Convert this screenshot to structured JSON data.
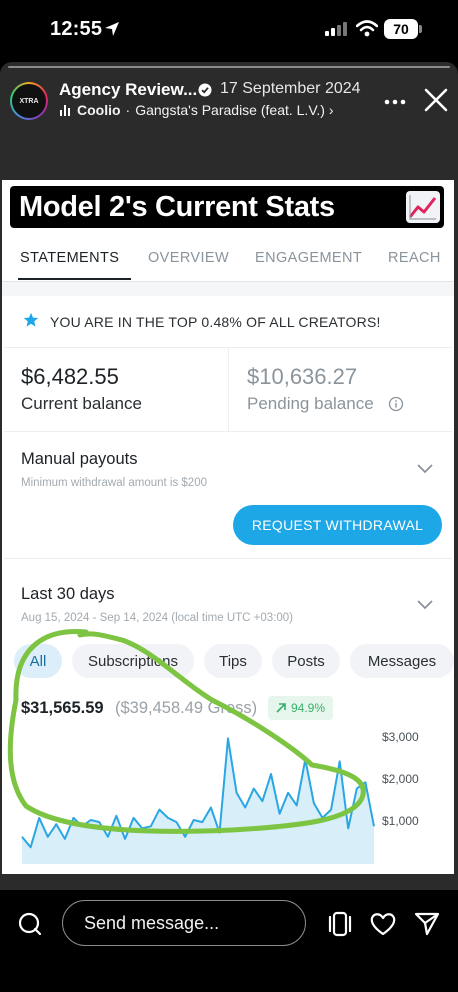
{
  "status_bar": {
    "time": "12:55",
    "battery": "70",
    "icons": [
      "location-arrow-icon",
      "cellular-signal-icon",
      "wifi-icon",
      "battery-icon"
    ]
  },
  "story_header": {
    "account_name": "Agency Review...",
    "date": "17 September 2024",
    "music_artist": "Coolio",
    "music_separator": " · ",
    "music_track": "Gangsta's Paradise (feat. L.V.) ›",
    "icons": [
      "verified-badge-icon",
      "music-bars-icon",
      "more-options-icon",
      "close-icon"
    ]
  },
  "card": {
    "title": "Model 2's Current Stats",
    "title_icon": "chart-increasing-icon",
    "tabs": [
      {
        "label": "STATEMENTS",
        "active": true
      },
      {
        "label": "OVERVIEW",
        "active": false
      },
      {
        "label": "ENGAGEMENT",
        "active": false
      },
      {
        "label": "REACH",
        "active": false
      }
    ],
    "top_notice": "YOU ARE IN THE TOP 0.48% OF ALL CREATORS!",
    "current_balance": {
      "amount": "$6,482.55",
      "label": "Current balance"
    },
    "pending_balance": {
      "amount": "$10,636.27",
      "label": "Pending balance"
    },
    "payouts": {
      "title": "Manual payouts",
      "subtitle": "Minimum withdrawal amount is $200",
      "button": "REQUEST WITHDRAWAL"
    },
    "period": {
      "title": "Last 30 days",
      "subtitle": "Aug 15, 2024 - Sep 14, 2024 (local time UTC +03:00)"
    },
    "filters": [
      {
        "label": "All",
        "active": true
      },
      {
        "label": "Subscriptions",
        "active": false
      },
      {
        "label": "Tips",
        "active": false
      },
      {
        "label": "Posts",
        "active": false
      },
      {
        "label": "Messages",
        "active": false
      }
    ],
    "earnings": {
      "net": "$31,565.59",
      "gross": "($39,458.49 Gross)",
      "change": "94.9%"
    },
    "colors": {
      "accent": "#1ea7e7",
      "chart_line": "#2aa6e3",
      "chart_fill": "#d8eef9",
      "annotation": "#7cc442",
      "positive": "#38b06a"
    }
  },
  "chart_data": {
    "type": "area",
    "y_ticks": [
      "$3,000",
      "$2,000",
      "$1,000"
    ],
    "ylim": [
      0,
      3200
    ],
    "grid": false,
    "values": [
      650,
      400,
      1100,
      650,
      950,
      600,
      1100,
      900,
      1050,
      1000,
      650,
      1150,
      600,
      1100,
      850,
      900,
      1300,
      1100,
      1000,
      650,
      1050,
      1000,
      1350,
      750,
      3000,
      1700,
      1350,
      1800,
      1500,
      2150,
      1200,
      1700,
      1400,
      2500,
      1450,
      1100,
      1300,
      2450,
      850,
      1800,
      1950,
      900
    ]
  },
  "bottom_bar": {
    "message_placeholder": "Send message...",
    "icons": [
      "camera-icon",
      "stack-icon",
      "heart-icon",
      "send-icon"
    ]
  }
}
